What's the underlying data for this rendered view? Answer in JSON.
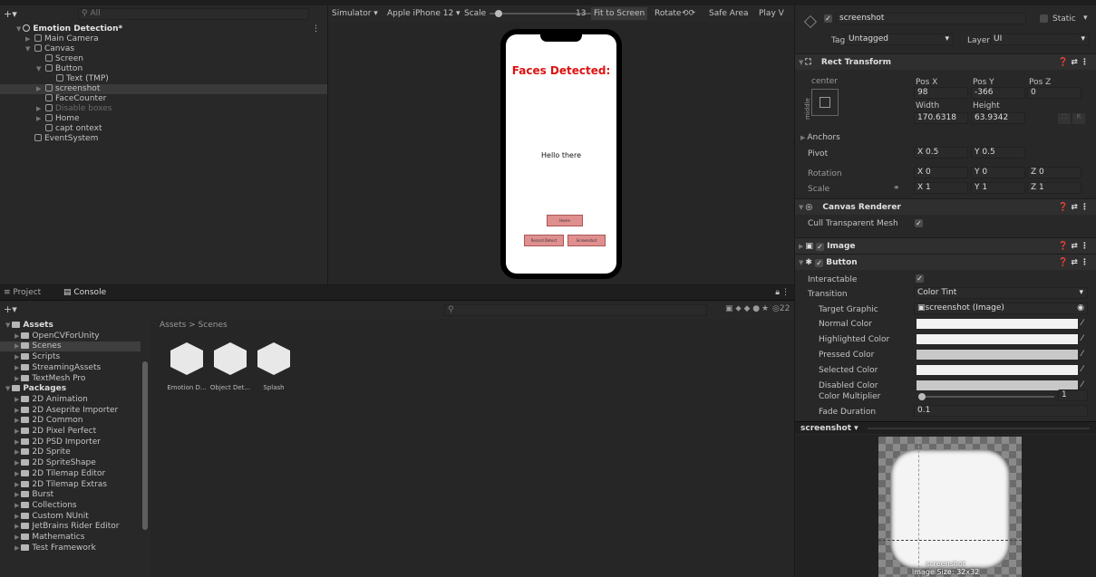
{
  "hierarchy": {
    "search_placeholder": "All",
    "scene": "Emotion Detection*",
    "items": [
      {
        "label": "Main Camera",
        "indent": 2,
        "tri": "▶",
        "dim": false
      },
      {
        "label": "Canvas",
        "indent": 2,
        "tri": "▼",
        "dim": false
      },
      {
        "label": "Screen",
        "indent": 3,
        "tri": "",
        "dim": false
      },
      {
        "label": "Button",
        "indent": 3,
        "tri": "▼",
        "dim": false
      },
      {
        "label": "Text (TMP)",
        "indent": 4,
        "tri": "",
        "dim": false
      },
      {
        "label": "screenshot",
        "indent": 3,
        "tri": "▶",
        "dim": false,
        "selected": true
      },
      {
        "label": "FaceCounter",
        "indent": 3,
        "tri": "",
        "dim": false
      },
      {
        "label": "Disable boxes",
        "indent": 3,
        "tri": "▶",
        "dim": true
      },
      {
        "label": "Home",
        "indent": 3,
        "tri": "▶",
        "dim": false
      },
      {
        "label": "capt ontext",
        "indent": 3,
        "tri": "",
        "dim": false
      },
      {
        "label": "EventSystem",
        "indent": 2,
        "tri": "",
        "dim": false
      }
    ]
  },
  "simulator": {
    "mode": "Simulator ▾",
    "device": "Apple iPhone 12 ▾",
    "scale_label": "Scale",
    "scale_value": "13",
    "scale_fraction": 0.05,
    "fit_label": "Fit to Screen",
    "rotate_label": "Rotate",
    "safe_area_label": "Safe Area",
    "play_label": "Play V",
    "faces_text": "Faces Detected:",
    "hello_text": "Hello there",
    "btn_home": "Home",
    "btn_left": "Record Detect",
    "btn_right": "Screenshot"
  },
  "project": {
    "tab_project": "Project",
    "tab_console": "Console",
    "breadcrumb": "Assets > Scenes",
    "count": "22",
    "tree": [
      {
        "label": "Assets",
        "indent": 0,
        "bold": true
      },
      {
        "label": "OpenCVForUnity",
        "indent": 1
      },
      {
        "label": "Scenes",
        "indent": 1,
        "selected": true
      },
      {
        "label": "Scripts",
        "indent": 1
      },
      {
        "label": "StreamingAssets",
        "indent": 1
      },
      {
        "label": "TextMesh Pro",
        "indent": 1
      },
      {
        "label": "Packages",
        "indent": 0,
        "bold": true
      },
      {
        "label": "2D Animation",
        "indent": 1
      },
      {
        "label": "2D Aseprite Importer",
        "indent": 1
      },
      {
        "label": "2D Common",
        "indent": 1
      },
      {
        "label": "2D Pixel Perfect",
        "indent": 1
      },
      {
        "label": "2D PSD Importer",
        "indent": 1
      },
      {
        "label": "2D Sprite",
        "indent": 1
      },
      {
        "label": "2D SpriteShape",
        "indent": 1
      },
      {
        "label": "2D Tilemap Editor",
        "indent": 1
      },
      {
        "label": "2D Tilemap Extras",
        "indent": 1
      },
      {
        "label": "Burst",
        "indent": 1
      },
      {
        "label": "Collections",
        "indent": 1
      },
      {
        "label": "Custom NUnit",
        "indent": 1
      },
      {
        "label": "JetBrains Rider Editor",
        "indent": 1
      },
      {
        "label": "Mathematics",
        "indent": 1
      },
      {
        "label": "Test Framework",
        "indent": 1
      }
    ],
    "assets": [
      "Emotion D...",
      "Object Det...",
      "Splash"
    ]
  },
  "inspector": {
    "name": "screenshot",
    "static_label": "Static",
    "tag_label": "Tag",
    "tag_value": "Untagged",
    "layer_label": "Layer",
    "layer_value": "UI",
    "rect_title": "Rect Transform",
    "anchor_top": "center",
    "anchor_side": "middle",
    "posx_label": "Pos X",
    "posx": "98",
    "posy_label": "Pos Y",
    "posy": "-366",
    "posz_label": "Pos Z",
    "posz": "0",
    "width_label": "Width",
    "width": "170.6318",
    "height_label": "Height",
    "height": "63.9342",
    "anchors_label": "Anchors",
    "pivot_label": "Pivot",
    "pivot_x": "0.5",
    "pivot_y": "0.5",
    "rotation_label": "Rotation",
    "rot_x": "0",
    "rot_y": "0",
    "rot_z": "0",
    "scale_label": "Scale",
    "scale_x": "1",
    "scale_y": "1",
    "scale_z": "1",
    "canvas_renderer": "Canvas Renderer",
    "cull_label": "Cull Transparent Mesh",
    "image_title": "Image",
    "button_title": "Button",
    "interactable_label": "Interactable",
    "transition_label": "Transition",
    "transition_value": "Color Tint",
    "target_label": "Target Graphic",
    "target_value": "screenshot (Image)",
    "colors": [
      {
        "label": "Normal Color",
        "fill": "#f2f2f2"
      },
      {
        "label": "Highlighted Color",
        "fill": "#f2f2f2"
      },
      {
        "label": "Pressed Color",
        "fill": "#c8c8c8"
      },
      {
        "label": "Selected Color",
        "fill": "#f2f2f2"
      },
      {
        "label": "Disabled Color",
        "fill": "#c8c8c8"
      }
    ],
    "multiplier_label": "Color Multiplier",
    "multiplier_value": "1",
    "multiplier_fraction": 0.0,
    "fade_label": "Fade Duration",
    "fade_value": "0.1",
    "preview_title": "screenshot ▾",
    "preview_name": "screenshot",
    "preview_size": "Image Size: 32x32"
  }
}
